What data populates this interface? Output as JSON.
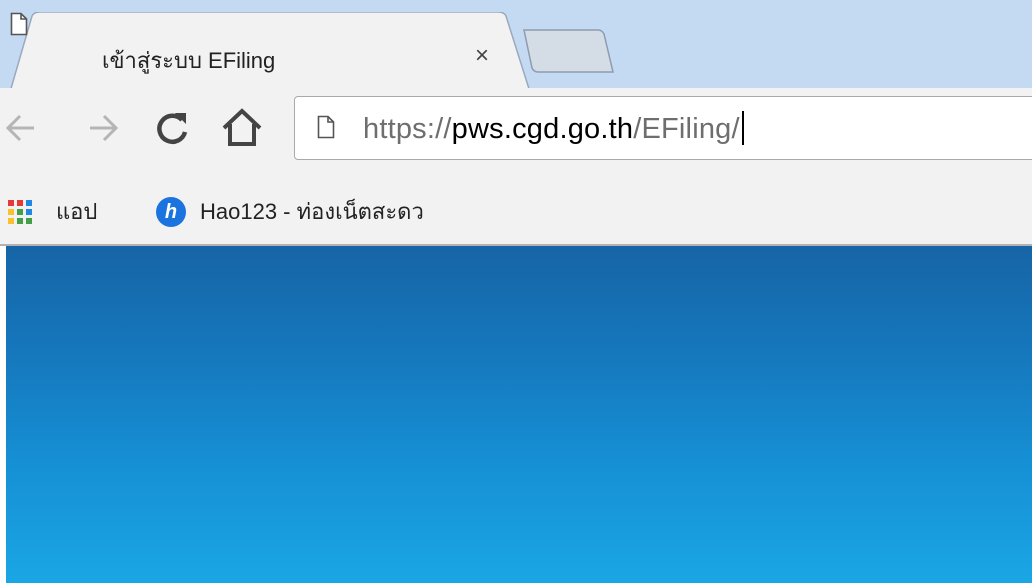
{
  "tab": {
    "title": "เข้าสู่ระบบ EFiling",
    "close_glyph": "×",
    "favicon": "page-icon"
  },
  "toolbar": {
    "back_icon": "back-arrow-icon",
    "forward_icon": "forward-arrow-icon",
    "reload_icon": "reload-icon",
    "home_icon": "home-icon"
  },
  "omnibox": {
    "scheme": "https://",
    "host": "pws.cgd.go.th",
    "path": "/EFiling/"
  },
  "bookmarks": {
    "apps_label": "แอป",
    "hao_label": "Hao123 - ท่องเน็ตสะดว",
    "hao_icon_letter": "h"
  },
  "colors": {
    "tabstrip": "#c4daf3",
    "toolbar": "#f2f2f2",
    "content_top": "#1665a6",
    "content_bottom": "#1aa6e4"
  }
}
